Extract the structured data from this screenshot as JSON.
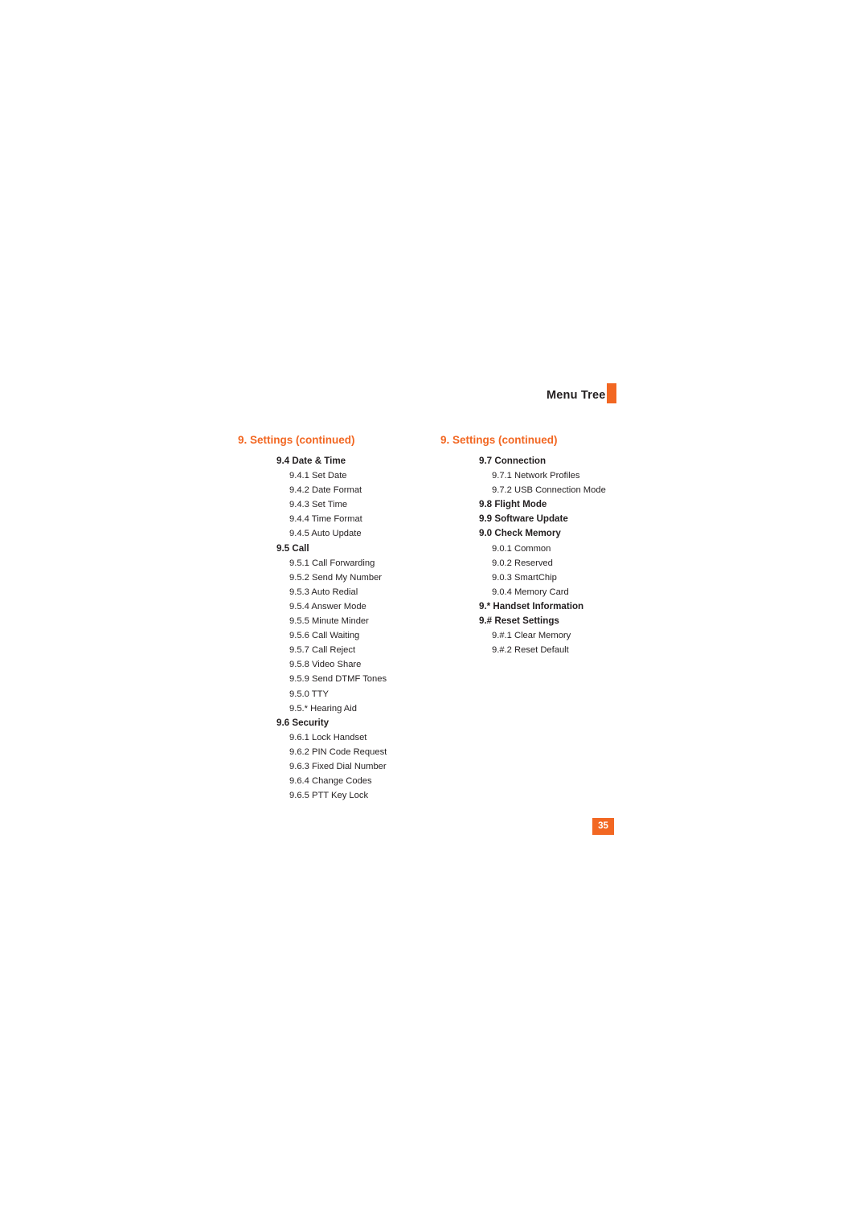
{
  "header": {
    "title": "Menu Tree"
  },
  "page_number": "35",
  "columns": [
    {
      "title": "9. Settings (continued)",
      "items": [
        {
          "level": 1,
          "text": "9.4 Date & Time"
        },
        {
          "level": 2,
          "text": "9.4.1 Set Date"
        },
        {
          "level": 2,
          "text": "9.4.2 Date Format"
        },
        {
          "level": 2,
          "text": "9.4.3 Set Time"
        },
        {
          "level": 2,
          "text": "9.4.4 Time Format"
        },
        {
          "level": 2,
          "text": "9.4.5 Auto Update"
        },
        {
          "level": 1,
          "text": "9.5 Call"
        },
        {
          "level": 2,
          "text": "9.5.1 Call Forwarding"
        },
        {
          "level": 2,
          "text": "9.5.2 Send My Number"
        },
        {
          "level": 2,
          "text": "9.5.3 Auto Redial"
        },
        {
          "level": 2,
          "text": "9.5.4 Answer Mode"
        },
        {
          "level": 2,
          "text": "9.5.5 Minute Minder"
        },
        {
          "level": 2,
          "text": "9.5.6 Call Waiting"
        },
        {
          "level": 2,
          "text": "9.5.7 Call Reject"
        },
        {
          "level": 2,
          "text": "9.5.8 Video Share"
        },
        {
          "level": 2,
          "text": "9.5.9 Send DTMF Tones"
        },
        {
          "level": 2,
          "text": "9.5.0 TTY"
        },
        {
          "level": 2,
          "text": "9.5.* Hearing Aid"
        },
        {
          "level": 1,
          "text": "9.6 Security"
        },
        {
          "level": 2,
          "text": "9.6.1 Lock Handset"
        },
        {
          "level": 2,
          "text": "9.6.2 PIN Code Request"
        },
        {
          "level": 2,
          "text": "9.6.3 Fixed Dial Number"
        },
        {
          "level": 2,
          "text": "9.6.4 Change Codes"
        },
        {
          "level": 2,
          "text": "9.6.5 PTT Key Lock"
        }
      ]
    },
    {
      "title": "9. Settings (continued)",
      "items": [
        {
          "level": 1,
          "text": "9.7 Connection"
        },
        {
          "level": 2,
          "text": "9.7.1 Network Profiles"
        },
        {
          "level": 2,
          "text": "9.7.2 USB Connection Mode"
        },
        {
          "level": 1,
          "text": "9.8 Flight Mode"
        },
        {
          "level": 1,
          "text": "9.9 Software Update"
        },
        {
          "level": 1,
          "text": "9.0 Check Memory"
        },
        {
          "level": 2,
          "text": "9.0.1 Common"
        },
        {
          "level": 2,
          "text": "9.0.2 Reserved"
        },
        {
          "level": 2,
          "text": "9.0.3 SmartChip"
        },
        {
          "level": 2,
          "text": "9.0.4 Memory Card"
        },
        {
          "level": 1,
          "text": "9.* Handset Information"
        },
        {
          "level": 1,
          "text": "9.# Reset Settings"
        },
        {
          "level": 2,
          "text": "9.#.1 Clear Memory"
        },
        {
          "level": 2,
          "text": "9.#.2 Reset Default"
        }
      ]
    }
  ]
}
